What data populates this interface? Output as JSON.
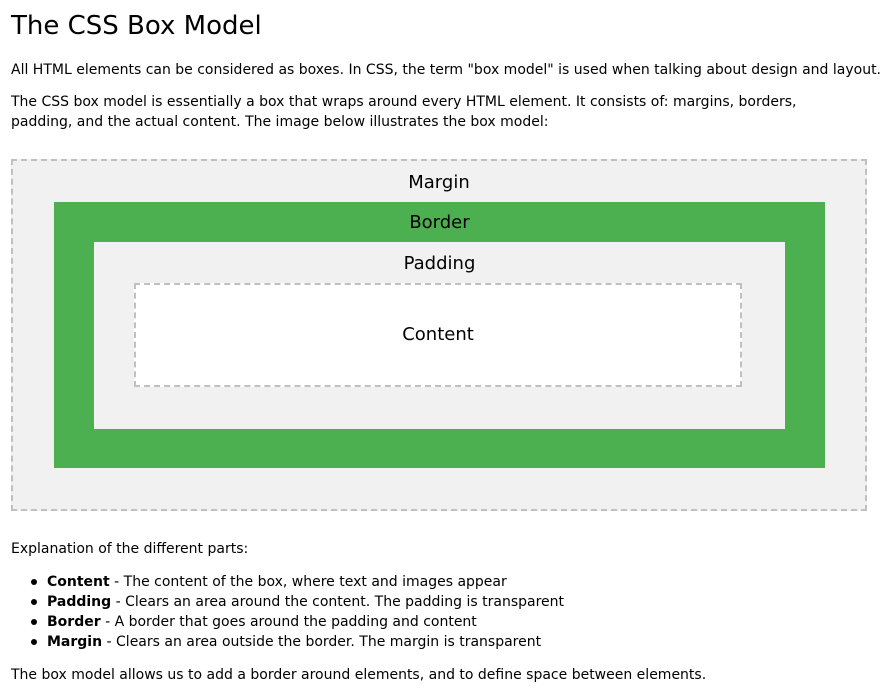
{
  "title": "The CSS Box Model",
  "intro": "All HTML elements can be considered as boxes. In CSS, the term \"box model\" is used when talking about design and layout.",
  "description": "The CSS box model is essentially a box that wraps around every HTML element. It consists of: margins, borders, padding, and the actual content. The image below illustrates the box model:",
  "diagram": {
    "margin_label": "Margin",
    "border_label": "Border",
    "padding_label": "Padding",
    "content_label": "Content",
    "colors": {
      "margin_bg": "#f1f1f1",
      "border_bg": "#4caf50",
      "padding_bg": "#f1f1f1",
      "content_bg": "#ffffff",
      "dashed_outline": "#c0c0c0"
    }
  },
  "explanation_heading": "Explanation of the different parts:",
  "parts": [
    {
      "term": "Content",
      "desc": " - The content of the box, where text and images appear"
    },
    {
      "term": "Padding",
      "desc": " - Clears an area around the content. The padding is transparent"
    },
    {
      "term": "Border",
      "desc": " - A border that goes around the padding and content"
    },
    {
      "term": "Margin",
      "desc": " - Clears an area outside the border. The margin is transparent"
    }
  ],
  "closing": "The box model allows us to add a border around elements, and to define space between elements."
}
